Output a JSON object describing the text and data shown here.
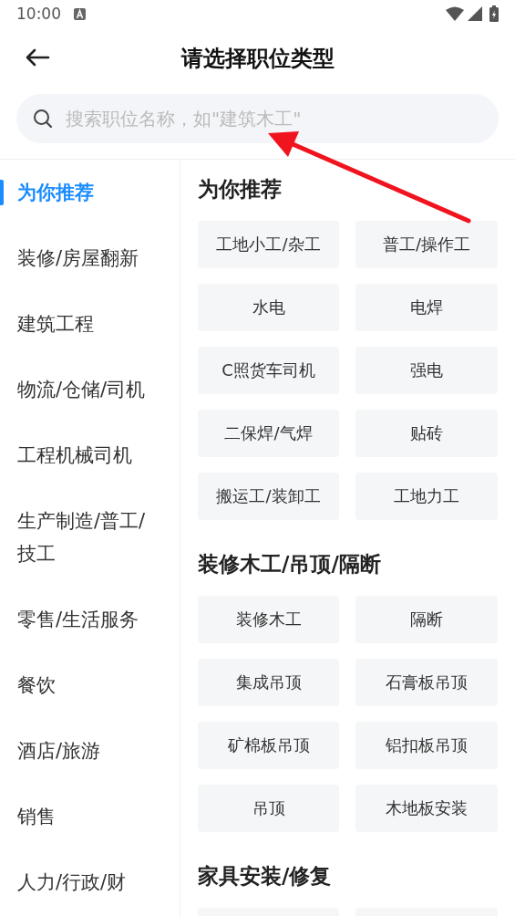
{
  "status_bar": {
    "time": "10:00"
  },
  "header": {
    "title": "请选择职位类型"
  },
  "search": {
    "placeholder": "搜索职位名称，如\"建筑木工\""
  },
  "sidebar": {
    "items": [
      {
        "label": "为你推荐",
        "selected": true
      },
      {
        "label": "装修/房屋翻新",
        "selected": false
      },
      {
        "label": "建筑工程",
        "selected": false
      },
      {
        "label": "物流/仓储/司机",
        "selected": false
      },
      {
        "label": "工程机械司机",
        "selected": false
      },
      {
        "label": "生产制造/普工/技工",
        "selected": false
      },
      {
        "label": "零售/生活服务",
        "selected": false
      },
      {
        "label": "餐饮",
        "selected": false
      },
      {
        "label": "酒店/旅游",
        "selected": false
      },
      {
        "label": "销售",
        "selected": false
      },
      {
        "label": "人力/行政/财",
        "selected": false
      }
    ]
  },
  "sections": [
    {
      "title": "为你推荐",
      "items": [
        {
          "kind": "label",
          "label": "工地小工/杂工"
        },
        {
          "kind": "label",
          "label": "普工/操作工"
        },
        {
          "kind": "label",
          "label": "水电"
        },
        {
          "kind": "label",
          "label": "电焊"
        },
        {
          "kind": "label",
          "label": "C照货车司机"
        },
        {
          "kind": "label",
          "label": "强电"
        },
        {
          "kind": "label",
          "label": "二保焊/气焊"
        },
        {
          "kind": "label",
          "label": "贴砖"
        },
        {
          "kind": "label",
          "label": "搬运工/装卸工"
        },
        {
          "kind": "label",
          "label": "工地力工"
        }
      ]
    },
    {
      "title": "装修木工/吊顶/隔断",
      "items": [
        {
          "kind": "label",
          "label": "装修木工"
        },
        {
          "kind": "label",
          "label": "隔断"
        },
        {
          "kind": "label",
          "label": "集成吊顶"
        },
        {
          "kind": "label",
          "label": "石膏板吊顶"
        },
        {
          "kind": "label",
          "label": "矿棉板吊顶"
        },
        {
          "kind": "label",
          "label": "铝扣板吊顶"
        },
        {
          "kind": "label",
          "label": "吊顶"
        },
        {
          "kind": "label",
          "label": "木地板安装"
        }
      ]
    },
    {
      "title": "家具安装/修复",
      "items": [
        {
          "kind": "blank"
        },
        {
          "kind": "blank"
        }
      ]
    }
  ],
  "annotation": {
    "kind": "arrow"
  }
}
